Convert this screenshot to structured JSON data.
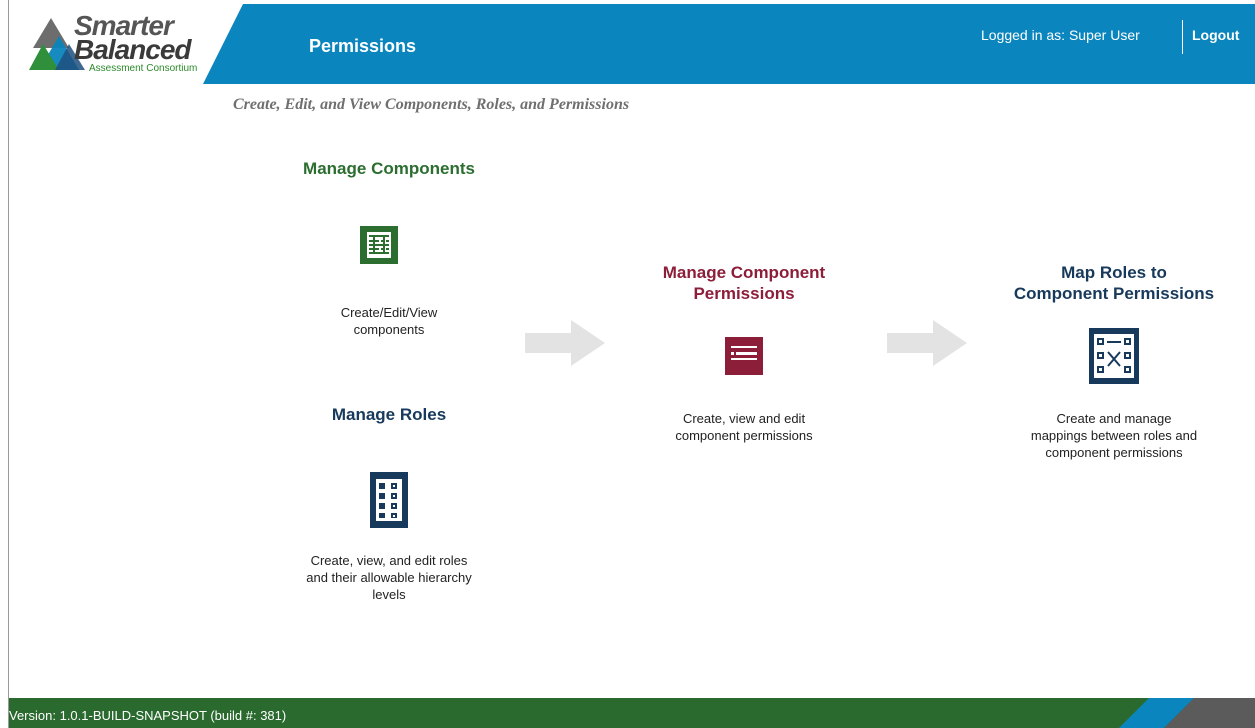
{
  "header": {
    "logo": {
      "word1": "Smarter",
      "word2": "Balanced",
      "tagline": "Assessment Consortium"
    },
    "page_title": "Permissions",
    "logged_in_text": "Logged in as: Super User",
    "logout_label": "Logout"
  },
  "subtitle": "Create, Edit, and View Components, Roles, and Permissions",
  "cards": {
    "components": {
      "title": "Manage Components",
      "icon": "table-grid-icon",
      "desc_line1": "Create/Edit/View",
      "desc_line2": "components"
    },
    "roles": {
      "title": "Manage Roles",
      "icon": "roles-list-icon",
      "desc_line1": "Create, view, and edit roles",
      "desc_line2": "and their allowable hierarchy",
      "desc_line3": "levels"
    },
    "component_permissions": {
      "title_line1": "Manage Component",
      "title_line2": "Permissions",
      "icon": "permissions-list-icon",
      "desc_line1": "Create, view and edit",
      "desc_line2": "component permissions"
    },
    "map_roles": {
      "title_line1": "Map Roles to",
      "title_line2": "Component Permissions",
      "icon": "mapping-icon",
      "desc_line1": "Create and manage",
      "desc_line2": "mappings between roles and",
      "desc_line3": "component permissions"
    }
  },
  "footer": {
    "version_text": "Version: 1.0.1-BUILD-SNAPSHOT (build #: 381)"
  },
  "colors": {
    "header_blue": "#0b85bd",
    "footer_green": "#2a6a2e",
    "components_green": "#2b6e30",
    "roles_navy": "#17395b",
    "permissions_maroon": "#8c1e3a",
    "arrow_gray": "#e3e3e3"
  }
}
